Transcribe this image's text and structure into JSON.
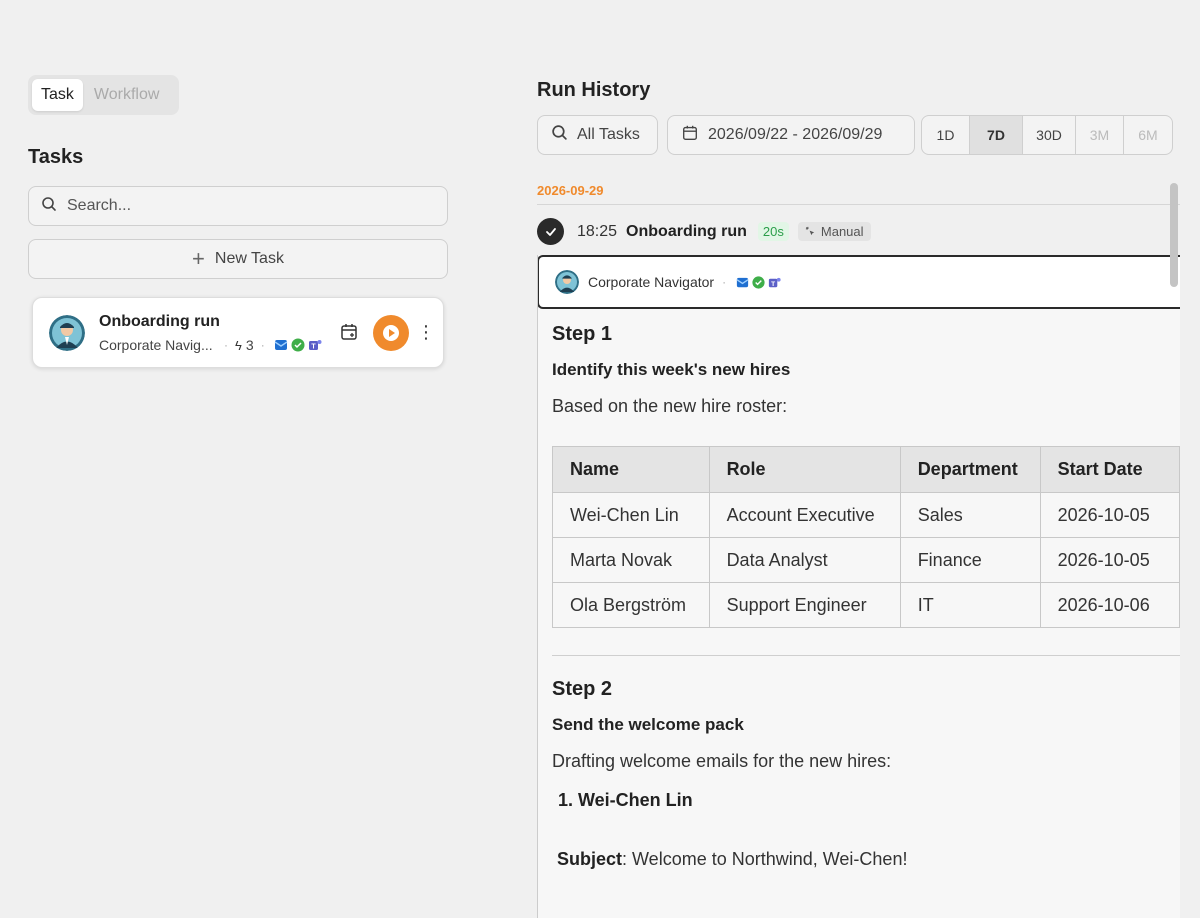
{
  "mode_tabs": [
    {
      "label": "Task",
      "active": true
    },
    {
      "label": "Workflow",
      "active": false
    }
  ],
  "tasks_panel": {
    "title": "Tasks",
    "search_placeholder": "Search...",
    "new_task_label": "New Task",
    "task": {
      "name": "Onboarding run",
      "agent": "Corporate Navig...",
      "trigger_count": "3",
      "integrations": [
        "outlook-icon",
        "sheets-icon",
        "teams-icon"
      ]
    }
  },
  "run_history": {
    "title": "Run History",
    "task_filter": "All Tasks",
    "date_range": "2026/09/22 - 2026/09/29",
    "ranges": [
      {
        "label": "1D",
        "state": "normal"
      },
      {
        "label": "7D",
        "state": "active"
      },
      {
        "label": "30D",
        "state": "normal"
      },
      {
        "label": "3M",
        "state": "disabled"
      },
      {
        "label": "6M",
        "state": "disabled"
      }
    ],
    "date_header": "2026-09-29",
    "run": {
      "time": "18:25",
      "name": "Onboarding run",
      "duration": "20s",
      "trigger": "Manual"
    },
    "detail": {
      "agent": "Corporate Navigator",
      "step1": {
        "title": "Step 1",
        "heading": "Identify this week's new hires",
        "intro": "Based on the new hire roster:",
        "table": {
          "headers": [
            "Name",
            "Role",
            "Department",
            "Start Date"
          ],
          "rows": [
            [
              "Wei-Chen Lin",
              "Account Executive",
              "Sales",
              "2026-10-05"
            ],
            [
              "Marta Novak",
              "Data Analyst",
              "Finance",
              "2026-10-05"
            ],
            [
              "Ola Bergström",
              "Support Engineer",
              "IT",
              "2026-10-06"
            ]
          ]
        }
      },
      "step2": {
        "title": "Step 2",
        "heading": "Send the welcome pack",
        "intro": "Drafting welcome emails for the new hires:",
        "list": [
          "Wei-Chen Lin"
        ],
        "subject_label": "Subject",
        "subject_value": ": Welcome to Northwind, Wei-Chen!"
      }
    }
  },
  "colors": {
    "accent": "#f08a2c",
    "success_bg": "#e2f6e6",
    "success_text": "#2b9e4a",
    "background": "#f0f0f0"
  }
}
